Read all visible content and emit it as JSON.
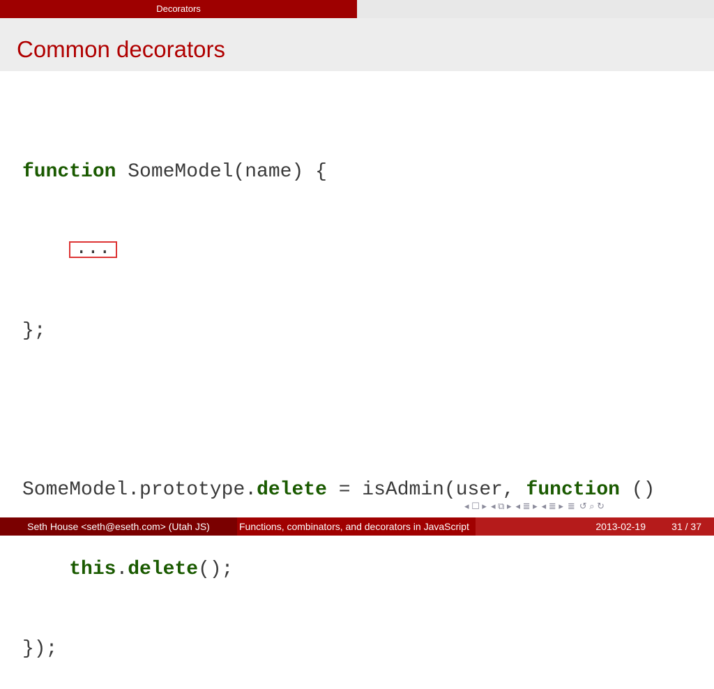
{
  "header": {
    "section_title": "Decorators"
  },
  "frame": {
    "title": "Common decorators"
  },
  "code": {
    "line1": {
      "kw1": "function",
      "rest": " SomeModel(name) {"
    },
    "line2": {
      "indent": "    ",
      "ellipsis": "..."
    },
    "line3": {
      "text": "};"
    },
    "line5": {
      "pre": "SomeModel.prototype.",
      "kw1": "delete",
      "mid": " = isAdmin(user, ",
      "kw2": "function",
      "post": " ()"
    },
    "line6": {
      "indent": "    ",
      "kw1": "this",
      "dot": ".",
      "kw2": "delete",
      "post": "();"
    },
    "line7": {
      "text": "});"
    }
  },
  "nav_icons": [
    "nav-first-icon",
    "nav-prev-frame-icon",
    "nav-prev-section-icon",
    "nav-next-section-icon",
    "nav-toc-icon",
    "nav-search-icon"
  ],
  "footer": {
    "author": "Seth House <seth@eseth.com>  (Utah JS)",
    "title": "Functions, combinators, and decorators in JavaScript",
    "date": "2013-02-19",
    "page": "31 / 37"
  },
  "colors": {
    "accent": "#9e0000",
    "title_red": "#b00000",
    "keyword_green": "#1a5a00",
    "highlight_box": "#dd3333"
  }
}
